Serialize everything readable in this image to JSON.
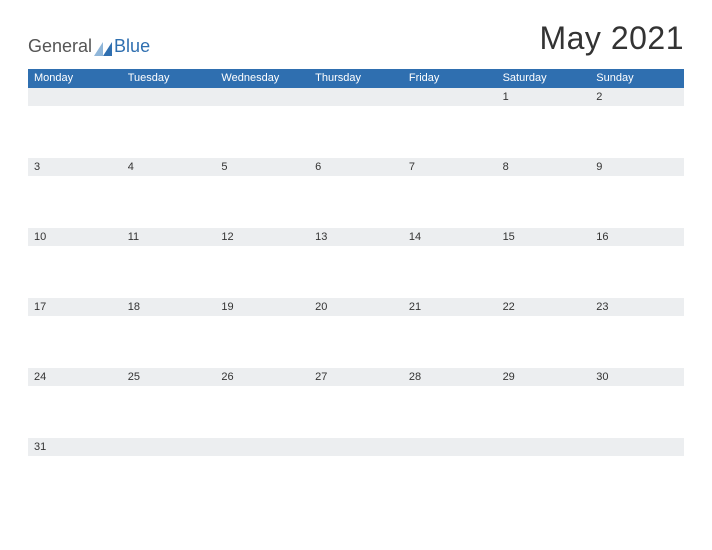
{
  "brand": {
    "part1": "General",
    "part2": "Blue"
  },
  "title": "May 2021",
  "days": [
    "Monday",
    "Tuesday",
    "Wednesday",
    "Thursday",
    "Friday",
    "Saturday",
    "Sunday"
  ],
  "weeks": [
    [
      "",
      "",
      "",
      "",
      "",
      "1",
      "2"
    ],
    [
      "3",
      "4",
      "5",
      "6",
      "7",
      "8",
      "9"
    ],
    [
      "10",
      "11",
      "12",
      "13",
      "14",
      "15",
      "16"
    ],
    [
      "17",
      "18",
      "19",
      "20",
      "21",
      "22",
      "23"
    ],
    [
      "24",
      "25",
      "26",
      "27",
      "28",
      "29",
      "30"
    ],
    [
      "31",
      "",
      "",
      "",
      "",
      "",
      ""
    ]
  ],
  "colors": {
    "accent": "#2f6fb0",
    "cellbg": "#eceef0"
  }
}
